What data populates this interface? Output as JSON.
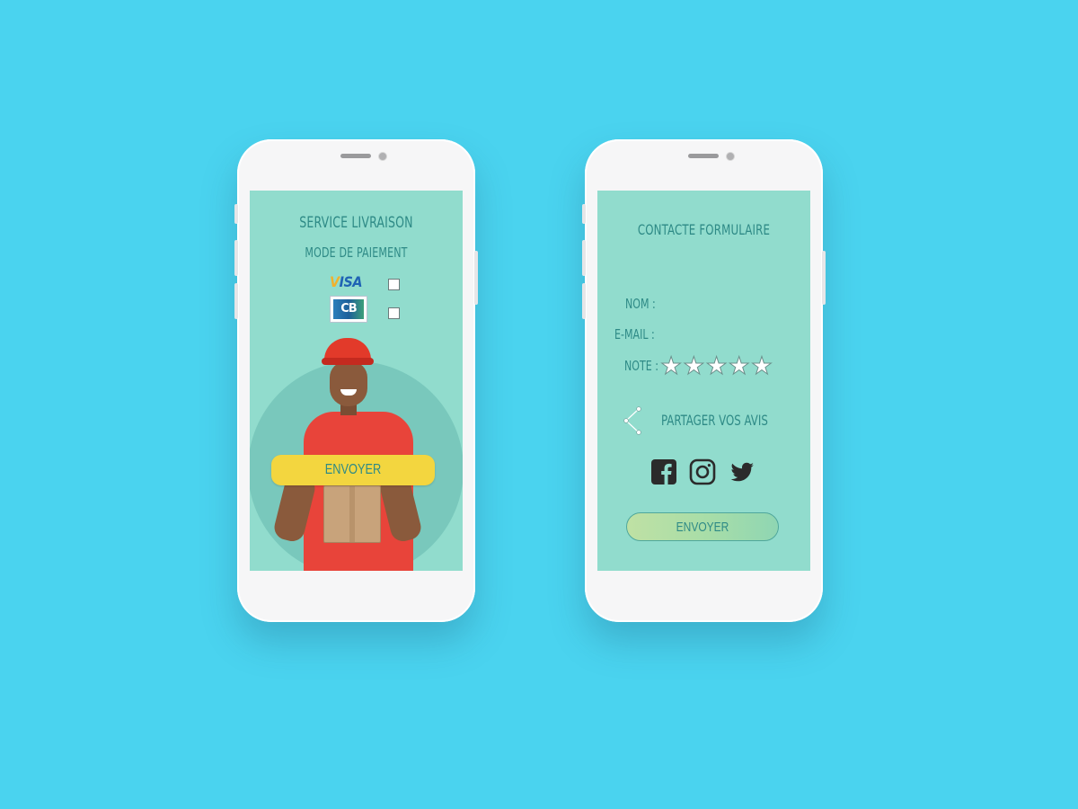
{
  "left_screen": {
    "title": "SERVICE LIVRAISON",
    "subtitle": "MODE DE PAIEMENT",
    "payment_methods": [
      {
        "brand": "VISA",
        "checked": false
      },
      {
        "brand": "CB",
        "checked": false
      }
    ],
    "submit_label": "ENVOYER"
  },
  "right_screen": {
    "title": "CONTACTE FORMULAIRE",
    "fields": {
      "name_label": "NOM :",
      "email_label": "E-MAIL :",
      "rating_label": "NOTE :"
    },
    "rating": {
      "value": 0,
      "max": 5
    },
    "share_label": "PARTAGER VOS AVIS",
    "social_icons": [
      "facebook-icon",
      "instagram-icon",
      "twitter-icon"
    ],
    "submit_label": "ENVOYER"
  },
  "colors": {
    "background": "#4ad3ef",
    "screen": "#91dccd",
    "text": "#2e8a86",
    "yellow_button": "#f3d63f",
    "green_button": "#a7dda8"
  }
}
